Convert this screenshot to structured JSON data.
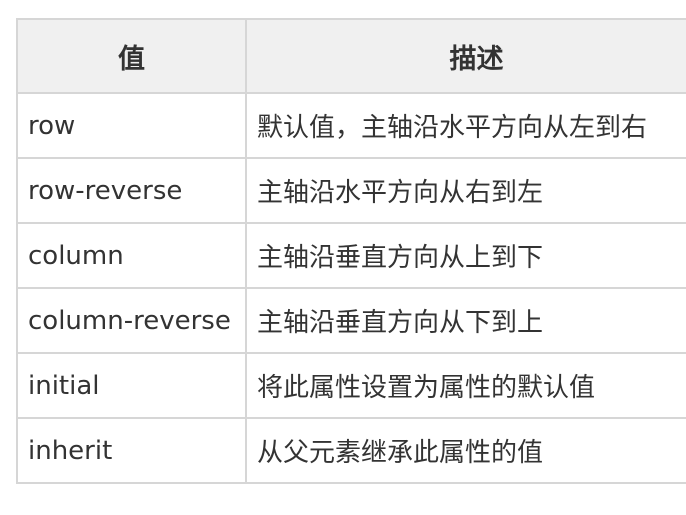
{
  "table": {
    "headers": [
      "值",
      "描述"
    ],
    "rows": [
      {
        "value": "row",
        "desc": "默认值，主轴沿水平方向从左到右"
      },
      {
        "value": "row-reverse",
        "desc": "主轴沿水平方向从右到左"
      },
      {
        "value": "column",
        "desc": "主轴沿垂直方向从上到下"
      },
      {
        "value": "column-reverse",
        "desc": "主轴沿垂直方向从下到上"
      },
      {
        "value": "initial",
        "desc": "将此属性设置为属性的默认值"
      },
      {
        "value": "inherit",
        "desc": "从父元素继承此属性的值"
      }
    ]
  }
}
